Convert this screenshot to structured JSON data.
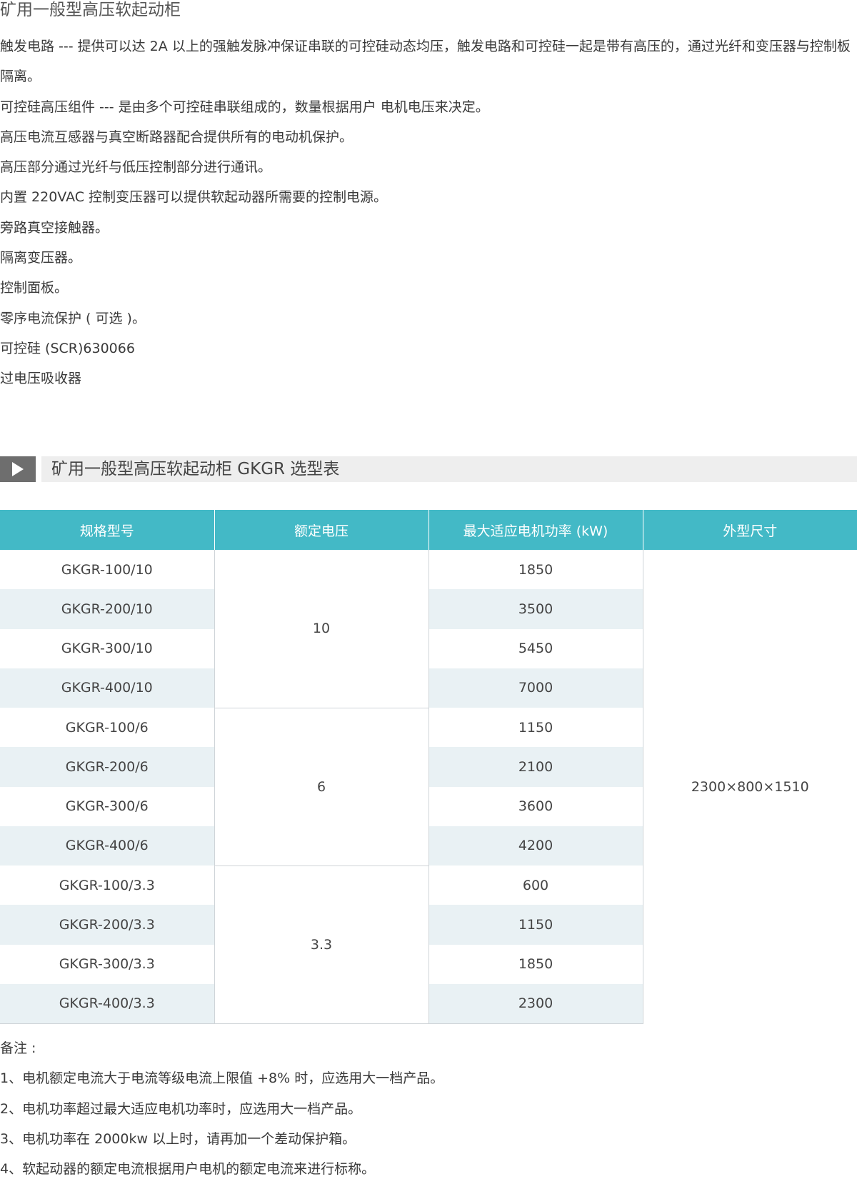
{
  "page": {
    "title": "矿用一般型高压软起动柜",
    "features": [
      "触发电路 --- 提供可以达 2A 以上的强触发脉冲保证串联的可控硅动态均压，触发电路和可控硅一起是带有高压的，通过光纤和变压器与控制板隔离。",
      "可控硅高压组件 --- 是由多个可控硅串联组成的，数量根据用户 电机电压来决定。",
      "高压电流互感器与真空断路器配合提供所有的电动机保护。",
      "高压部分通过光纤与低压控制部分进行通讯。",
      "内置 220VAC 控制变压器可以提供软起动器所需要的控制电源。",
      "旁路真空接触器。",
      "隔离变压器。",
      "控制面板。",
      "零序电流保护 ( 可选 )。",
      "可控硅 (SCR)630066",
      "过电压吸收器"
    ]
  },
  "section": {
    "title": "矿用一般型高压软起动柜 GKGR 选型表",
    "icon": "play-icon"
  },
  "table": {
    "headers": [
      "规格型号",
      "额定电压",
      "最大适应电机功率 (kW)",
      "外型尺寸"
    ],
    "rows": [
      {
        "model": "GKGR-100/10",
        "power": "1850"
      },
      {
        "model": "GKGR-200/10",
        "power": "3500"
      },
      {
        "model": "GKGR-300/10",
        "power": "5450"
      },
      {
        "model": "GKGR-400/10",
        "power": "7000"
      },
      {
        "model": "GKGR-100/6",
        "power": "1150"
      },
      {
        "model": "GKGR-200/6",
        "power": "2100"
      },
      {
        "model": "GKGR-300/6",
        "power": "3600"
      },
      {
        "model": "GKGR-400/6",
        "power": "4200"
      },
      {
        "model": "GKGR-100/3.3",
        "power": "600"
      },
      {
        "model": "GKGR-200/3.3",
        "power": "1150"
      },
      {
        "model": "GKGR-300/3.3",
        "power": "1850"
      },
      {
        "model": "GKGR-400/3.3",
        "power": "2300"
      }
    ],
    "voltage_groups": [
      "10",
      "6",
      "3.3"
    ],
    "size": "2300×800×1510"
  },
  "notes": {
    "head": "备注 :",
    "items": [
      "1、电机额定电流大于电流等级电流上限值 +8% 时，应选用大一档产品。",
      "2、电机功率超过最大适应电机功率时，应选用大一档产品。",
      "3、电机功率在 2000kw 以上时，请再加一个差动保护箱。",
      "4、软起动器的额定电流根据用户电机的额定电流来进行标称。"
    ]
  },
  "colors": {
    "header_bg": "#43b9c6",
    "stripe_bg": "#e9f1f4",
    "section_band": "#eeeeee",
    "section_icon_bg": "#6e6e6e"
  }
}
